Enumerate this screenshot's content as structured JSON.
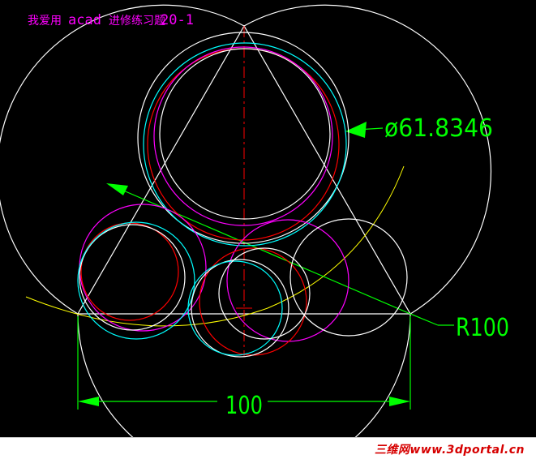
{
  "drawing": {
    "title_cn_1": "我爱用",
    "title_latin": "acad",
    "title_cn_2": "进修练习题",
    "title_num": "20-1",
    "dim_diameter": "ø61.8346",
    "dim_radius": "R100",
    "dim_width": "100"
  },
  "footer": {
    "watermark": "三维网www.3dportal.cn"
  },
  "colors": {
    "background": "#000000",
    "white": "#ffffff",
    "magenta": "#ff00ff",
    "red": "#ff0000",
    "cyan": "#00ffff",
    "yellow": "#ffff00",
    "green": "#00ff00",
    "title": "#ff00ff"
  }
}
